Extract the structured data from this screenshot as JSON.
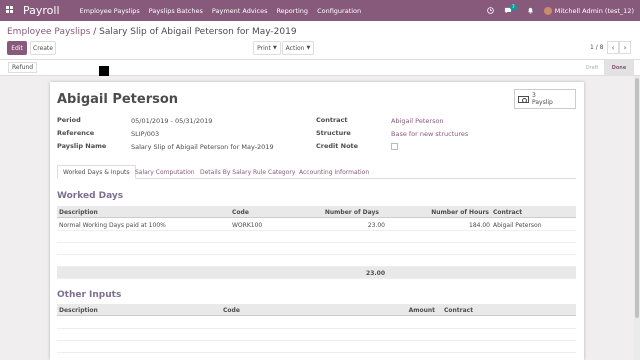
{
  "navbar": {
    "app_title": "Payroll",
    "menu": [
      "Employee Payslips",
      "Payslips Batches",
      "Payment Advices",
      "Reporting",
      "Configuration"
    ],
    "chat_count": "7",
    "user": "Mitchell Admin (test_12)"
  },
  "breadcrumb": {
    "parent": "Employee Payslips",
    "separator": " / ",
    "current": "Salary Slip of Abigail Peterson for May-2019"
  },
  "toolbar": {
    "edit": "Edit",
    "create": "Create",
    "print": "Print",
    "action": "Action",
    "pager": "1 / 8"
  },
  "statusbar": {
    "refund": "Refund",
    "stages": [
      "Draft",
      "Done"
    ],
    "active_stage": "Done"
  },
  "form": {
    "employee": "Abigail Peterson",
    "smart_button": {
      "count": "3",
      "label": "Payslip"
    },
    "period_label": "Period",
    "period_value": "05/01/2019 - 05/31/2019",
    "reference_label": "Reference",
    "reference_value": "SLIP/003",
    "payslip_name_label": "Payslip Name",
    "payslip_name_value": "Salary Slip of Abigail Peterson for May-2019",
    "contract_label": "Contract",
    "contract_value": "Abigail Peterson",
    "structure_label": "Structure",
    "structure_value": "Base for new structures",
    "credit_note_label": "Credit Note",
    "credit_note_checked": false
  },
  "tabs": [
    "Worked Days & Inputs",
    "Salary Computation",
    "Details By Salary Rule Category",
    "Accounting Information"
  ],
  "worked_days": {
    "title": "Worked Days",
    "columns": [
      "Description",
      "Code",
      "Number of Days",
      "Number of Hours",
      "Contract"
    ],
    "rows": [
      [
        "Normal Working Days paid at 100%",
        "WORK100",
        "23.00",
        "184.00",
        "Abigail Peterson"
      ]
    ],
    "total_days": "23.00"
  },
  "other_inputs": {
    "title": "Other Inputs",
    "columns": [
      "Description",
      "Code",
      "Amount",
      "Contract"
    ]
  },
  "colors": {
    "brand": "#875a7b",
    "section_title": "#7c6f8f"
  }
}
